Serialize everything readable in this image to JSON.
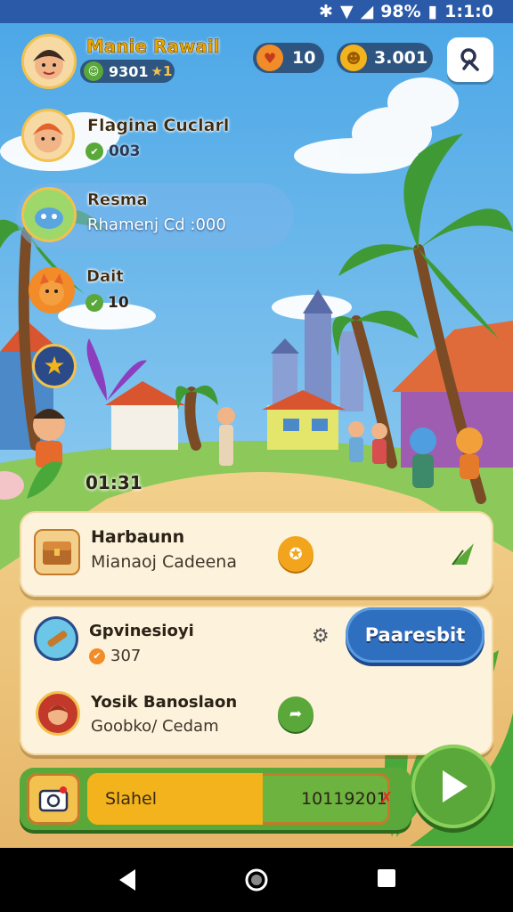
{
  "status_bar": {
    "battery": "98%",
    "time": "1:1:0"
  },
  "player": {
    "name": "Manie Rawail",
    "level_text": "9301",
    "star": "★1"
  },
  "currencies": [
    {
      "name": "hearts",
      "value": "10"
    },
    {
      "name": "gold",
      "value": "3.001"
    }
  ],
  "friends": [
    {
      "name": "Flagina Cuclarl",
      "score": "003"
    },
    {
      "name": "Resma",
      "sub": "Rhamenj Cd :000"
    },
    {
      "name": "Dait",
      "score": "10"
    }
  ],
  "timer": "01:31",
  "quest_card": {
    "title": "Harbaunn",
    "subtitle": "Mianaoj Cadeena"
  },
  "list_card": {
    "item1": {
      "title": "Gpvinesioyi",
      "value": "307"
    },
    "item2": {
      "title": "Yosik Banoslaon",
      "subtitle": "Goobko/ Cedam"
    }
  },
  "action_button": "Paaresbit",
  "progress": {
    "label": "Slahel",
    "value": "10119201",
    "fill_fraction": 0.58
  },
  "colors": {
    "sky": "#7fc4f0",
    "card": "#fdf3dc",
    "accent_green": "#5aa83a",
    "accent_blue": "#2f6fbf",
    "gold": "#f2b31c"
  }
}
